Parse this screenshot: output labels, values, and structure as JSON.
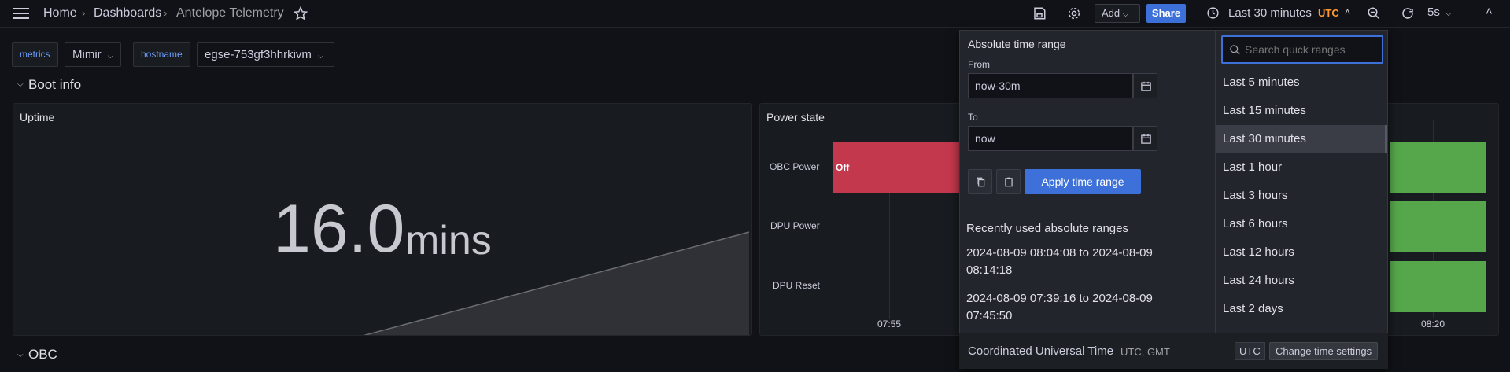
{
  "breadcrumb": {
    "home": "Home",
    "dashboards": "Dashboards",
    "current": "Antelope Telemetry"
  },
  "toolbar": {
    "add_label": "Add",
    "share_label": "Share",
    "time_range_label": "Last 30 minutes",
    "timezone": "UTC",
    "refresh_interval": "5s"
  },
  "variables": [
    {
      "label": "metrics",
      "value": "Mimir"
    },
    {
      "label": "hostname",
      "value": "egse-753gf3hhrkivm"
    }
  ],
  "rows": {
    "boot_info": "Boot info",
    "obc": "OBC"
  },
  "panels": {
    "uptime": {
      "title": "Uptime",
      "value": "16.0",
      "unit": "mins"
    },
    "power_state": {
      "title": "Power state",
      "series": [
        "OBC Power",
        "DPU Power",
        "DPU Reset"
      ],
      "state_label": "Off",
      "x_tick_left": "07:55",
      "x_tick_right": "08:20"
    }
  },
  "time_picker": {
    "absolute_heading": "Absolute time range",
    "from_label": "From",
    "from_value": "now-30m",
    "to_label": "To",
    "to_value": "now",
    "apply_label": "Apply time range",
    "recent_heading": "Recently used absolute ranges",
    "recent": [
      {
        "line1": "2024-08-09 08:04:08 to 2024-08-09",
        "line2": "08:14:18"
      },
      {
        "line1": "2024-08-09 07:39:16 to 2024-08-09",
        "line2": "07:45:50"
      }
    ],
    "search_placeholder": "Search quick ranges",
    "quick_ranges": [
      "Last 5 minutes",
      "Last 15 minutes",
      "Last 30 minutes",
      "Last 1 hour",
      "Last 3 hours",
      "Last 6 hours",
      "Last 12 hours",
      "Last 24 hours",
      "Last 2 days"
    ],
    "selected_quick_range": "Last 30 minutes",
    "footer_timezone": "Coordinated Universal Time",
    "footer_tz_abbr": "UTC, GMT",
    "footer_tz_badge": "UTC",
    "change_settings_label": "Change time settings"
  },
  "colors": {
    "accent": "#3d71d9",
    "state_off": "#c4384d",
    "state_on": "#56a64b",
    "timezone_text": "#ff9830"
  }
}
